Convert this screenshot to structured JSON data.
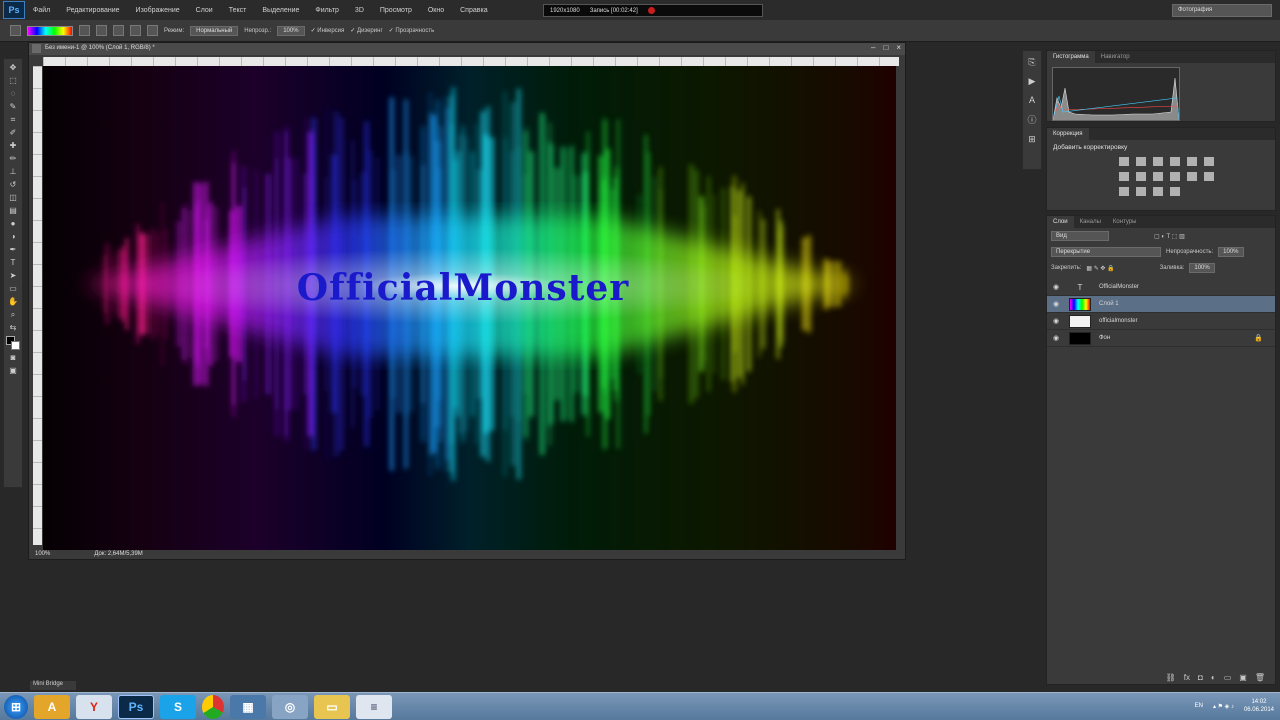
{
  "app": {
    "logo": "Ps"
  },
  "menu": [
    "Файл",
    "Редактирование",
    "Изображение",
    "Слои",
    "Текст",
    "Выделение",
    "Фильтр",
    "3D",
    "Просмотр",
    "Окно",
    "Справка"
  ],
  "recorder": {
    "resolution": "1920x1080",
    "status": "Запись [00:02:42]"
  },
  "window_controls": [
    "–",
    "□",
    "×"
  ],
  "options": {
    "mode_label": "Режим:",
    "mode_value": "Нормальный",
    "opacity_label": "Непрозр.:",
    "opacity_value": "100%",
    "inverse": "Инверсия",
    "dither": "Дизеринг",
    "transparency": "Прозрачность",
    "workspace": "Фотография"
  },
  "document": {
    "tab": "Без имени-1 @ 100% (Слой 1, RGB/8) *",
    "zoom": "100%",
    "doc_info": "Док: 2,64M/5,39M",
    "canvas_text": "OfficialMonster",
    "colors": {
      "glow_text": "#1a1acc",
      "background": "#050003"
    }
  },
  "panels": {
    "histogram_tabs": [
      "Гистограмма",
      "Навигатор"
    ],
    "corrections": {
      "tab": "Коррекция",
      "title": "Добавить корректировку"
    },
    "layers_tabs": [
      "Слои",
      "Каналы",
      "Контуры"
    ],
    "kind_filter": "Вид",
    "blend_mode": "Перекрытие",
    "opacity_label": "Непрозрачность:",
    "opacity_value": "100%",
    "lock_label": "Закрепить:",
    "fill_label": "Заливка:",
    "fill_value": "100%",
    "layers": [
      {
        "name": "OfficialMonster",
        "kind": "text",
        "selected": false,
        "locked": false,
        "thumb": "#3a3a3a"
      },
      {
        "name": "Слой 1",
        "kind": "gradient",
        "selected": true,
        "locked": false,
        "thumb": "gradient"
      },
      {
        "name": "officialmonster",
        "kind": "raster",
        "selected": false,
        "locked": false,
        "thumb": "#f2f2f2"
      },
      {
        "name": "Фон",
        "kind": "background",
        "selected": false,
        "locked": true,
        "thumb": "#000000"
      }
    ]
  },
  "minibridge": "Mini Bridge",
  "taskbar": {
    "apps": [
      "start-orb",
      "avast",
      "yandex",
      "photoshop",
      "skype",
      "chrome",
      "explorer",
      "media",
      "folder",
      "notepad"
    ],
    "lang": "EN",
    "time": "14:02",
    "date": "06.06.2014"
  }
}
